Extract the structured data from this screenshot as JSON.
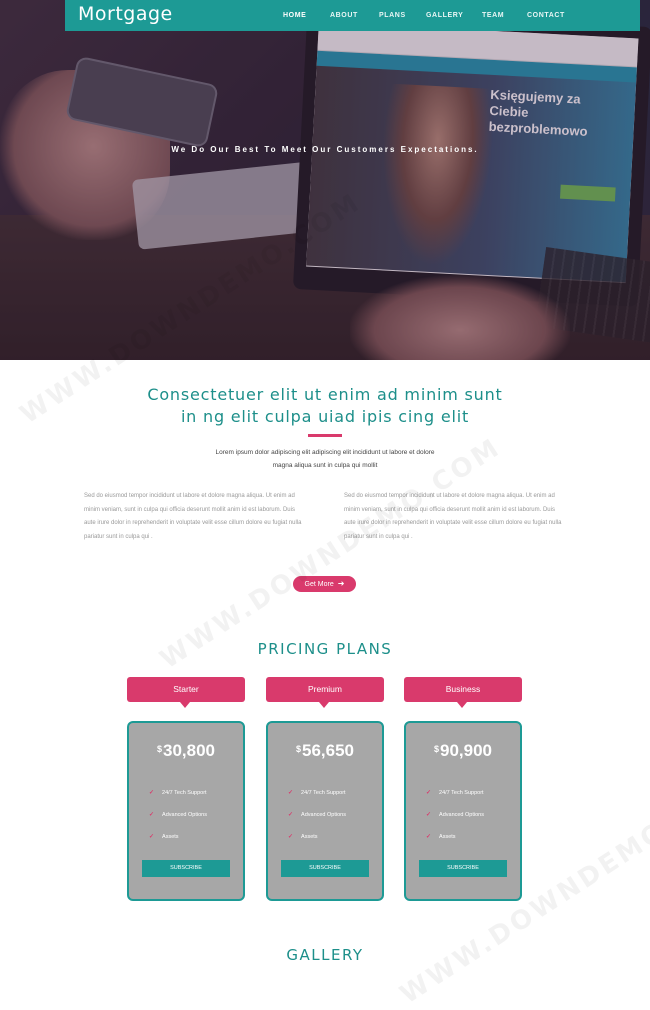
{
  "brand": {
    "logo": "Mortgage"
  },
  "nav": {
    "items": [
      {
        "label": "HOME",
        "active": true
      },
      {
        "label": "ABOUT"
      },
      {
        "label": "PLANS"
      },
      {
        "label": "GALLERY"
      },
      {
        "label": "TEAM"
      },
      {
        "label": "CONTACT"
      }
    ]
  },
  "hero": {
    "tagline": "We Do Our Best To Meet Our Customers Expectations.",
    "screen_text": "Księgujemy za Ciebie bezproblemowo"
  },
  "intro": {
    "title_line1": "Consectetuer elit ut enim ad minim sunt",
    "title_line2": "in ng elit culpa uiad ipis cing elit",
    "subtitle_line1": "Lorem ipsum dolor adipiscing elit adipiscing elit incididunt ut labore et dolore",
    "subtitle_line2": "magna aliqua sunt in culpa qui mollit",
    "col_left": "Sed do eiusmod tempor incididunt ut labore et dolore magna aliqua. Ut enim ad minim veniam, sunt in culpa qui officia deserunt mollit anim id est laborum. Duis aute irure dolor in reprehenderit in voluptate velit esse cillum dolore eu fugiat nulla pariatur sunt in culpa qui .",
    "col_right": "Sed do eiusmod tempor incididunt ut labore et dolore magna aliqua. Ut enim ad minim veniam, sunt in culpa qui officia deserunt mollit anim id est laborum. Duis aute irure dolor in reprehenderit in voluptate velit esse cillum dolore eu fugiat nulla pariatur sunt in culpa qui .",
    "more_label": "Get More",
    "more_icon": "arrow-right-icon"
  },
  "pricing": {
    "title": "PRICING PLANS",
    "currency": "$",
    "plans": [
      {
        "name": "Starter",
        "price": "30,800",
        "features": [
          "24/7 Tech Support",
          "Advanced Options",
          "Assets"
        ],
        "button": "SUBSCRIBE"
      },
      {
        "name": "Premium",
        "price": "56,650",
        "features": [
          "24/7 Tech Support",
          "Advanced Options",
          "Assets"
        ],
        "button": "SUBSCRIBE"
      },
      {
        "name": "Business",
        "price": "90,900",
        "features": [
          "24/7 Tech Support",
          "Advanced Options",
          "Assets"
        ],
        "button": "SUBSCRIBE"
      }
    ]
  },
  "gallery": {
    "title": "GALLERY"
  },
  "watermark": "WWW.DOWNDEMO.COM",
  "colors": {
    "teal": "#1d9a95",
    "pink": "#d93a6c",
    "card_grey": "#a7a7a7"
  }
}
